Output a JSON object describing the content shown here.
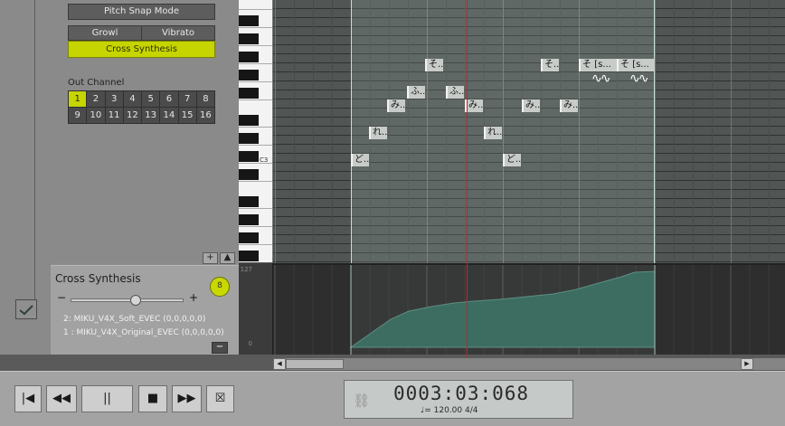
{
  "modes": {
    "pitch_snap": "Pitch Snap Mode",
    "growl": "Growl",
    "vibrato": "Vibrato",
    "cross_synthesis": "Cross Synthesis"
  },
  "out_channel": {
    "label": "Out Channel",
    "channels": [
      "1",
      "2",
      "3",
      "4",
      "5",
      "6",
      "7",
      "8",
      "9",
      "10",
      "11",
      "12",
      "13",
      "14",
      "15",
      "16"
    ],
    "selected": "1"
  },
  "panel_buttons": {
    "plus": "+",
    "up": "▲",
    "minus": "−"
  },
  "cross_synthesis": {
    "title": "Cross Synthesis",
    "knob_label": "8",
    "minus": "−",
    "plus": "+",
    "slider_value": 0.58,
    "sources": [
      "2: MIKU_V4X_Soft_EVEC (0,0,0,0,0)",
      "1 : MIKU_V4X_Original_EVEC (0,0,0,0,0)"
    ]
  },
  "piano": {
    "c3_label": "C3"
  },
  "notes": [
    {
      "lyric": "ど..."
    },
    {
      "lyric": "れ..."
    },
    {
      "lyric": "み..."
    },
    {
      "lyric": "ふ..."
    },
    {
      "lyric": "そ..."
    },
    {
      "lyric": "ふ..."
    },
    {
      "lyric": "み..."
    },
    {
      "lyric": "れ..."
    },
    {
      "lyric": "ど..."
    },
    {
      "lyric": "み..."
    },
    {
      "lyric": "そ..."
    },
    {
      "lyric": "み..."
    },
    {
      "lyric": "そ [s..."
    },
    {
      "lyric": "そ [s..."
    }
  ],
  "control_track": {
    "max_label": "127",
    "min_label": "0"
  },
  "scrollbar": {
    "left": "◀",
    "right": "▶"
  },
  "transport": {
    "rewind_start": "|◀",
    "rewind": "◀◀",
    "pause": "||",
    "stop": "■",
    "fast_forward": "▶▶",
    "loop_icon": "☒",
    "link_icon": "⛓",
    "time": "0003:03:068",
    "tempo": "♩= 120.00   4/4"
  },
  "colors": {
    "accent": "#c6d400",
    "playhead": "#d02020",
    "curve": "#3d6c61"
  }
}
